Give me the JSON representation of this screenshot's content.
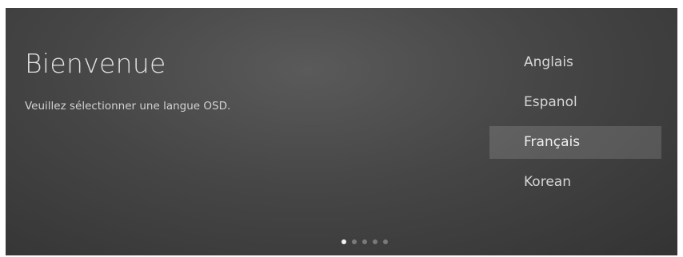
{
  "welcome": {
    "title": "Bienvenue",
    "subtitle": "Veuillez sélectionner une langue OSD."
  },
  "languages": [
    {
      "label": "Anglais",
      "selected": false
    },
    {
      "label": "Espanol",
      "selected": false
    },
    {
      "label": "Français",
      "selected": true
    },
    {
      "label": "Korean",
      "selected": false
    }
  ],
  "pager": {
    "total": 5,
    "current": 1
  },
  "colors": {
    "background": "#464646",
    "selection": "#5c5c5c",
    "text": "#e6e6e6",
    "active_dot": "#f2f2f2",
    "inactive_dot": "#7a7a7a"
  }
}
